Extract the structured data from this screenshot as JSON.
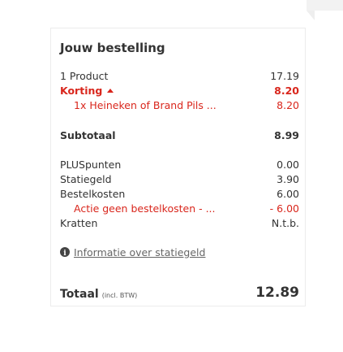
{
  "order": {
    "title": "Jouw bestelling",
    "product_count_label": "1 Product",
    "product_total": "17.19",
    "discount_label": "Korting",
    "discount_value": "8.20",
    "discount_item_label": "1x Heineken of Brand Pils ...",
    "discount_item_value": "8.20",
    "subtotal_label": "Subtotaal",
    "subtotal_value": "8.99",
    "plus_points_label": "PLUSpunten",
    "plus_points_value": "0.00",
    "deposit_label": "Statiegeld",
    "deposit_value": "3.90",
    "order_costs_label": "Bestelkosten",
    "order_costs_value": "6.00",
    "promo_label": "Actie geen bestelkosten - ...",
    "promo_value": "- 6.00",
    "crates_label": "Kratten",
    "crates_value": "N.t.b.",
    "deposit_info_link": "Informatie over statiegeld",
    "total_label": "Totaal",
    "total_note": "(incl. BTW)",
    "total_value": "12.89"
  },
  "colors": {
    "accent_red": "#d9261c",
    "text": "#333333"
  },
  "icons": {
    "discount_toggle": "caret-up-icon",
    "info": "info-icon"
  }
}
